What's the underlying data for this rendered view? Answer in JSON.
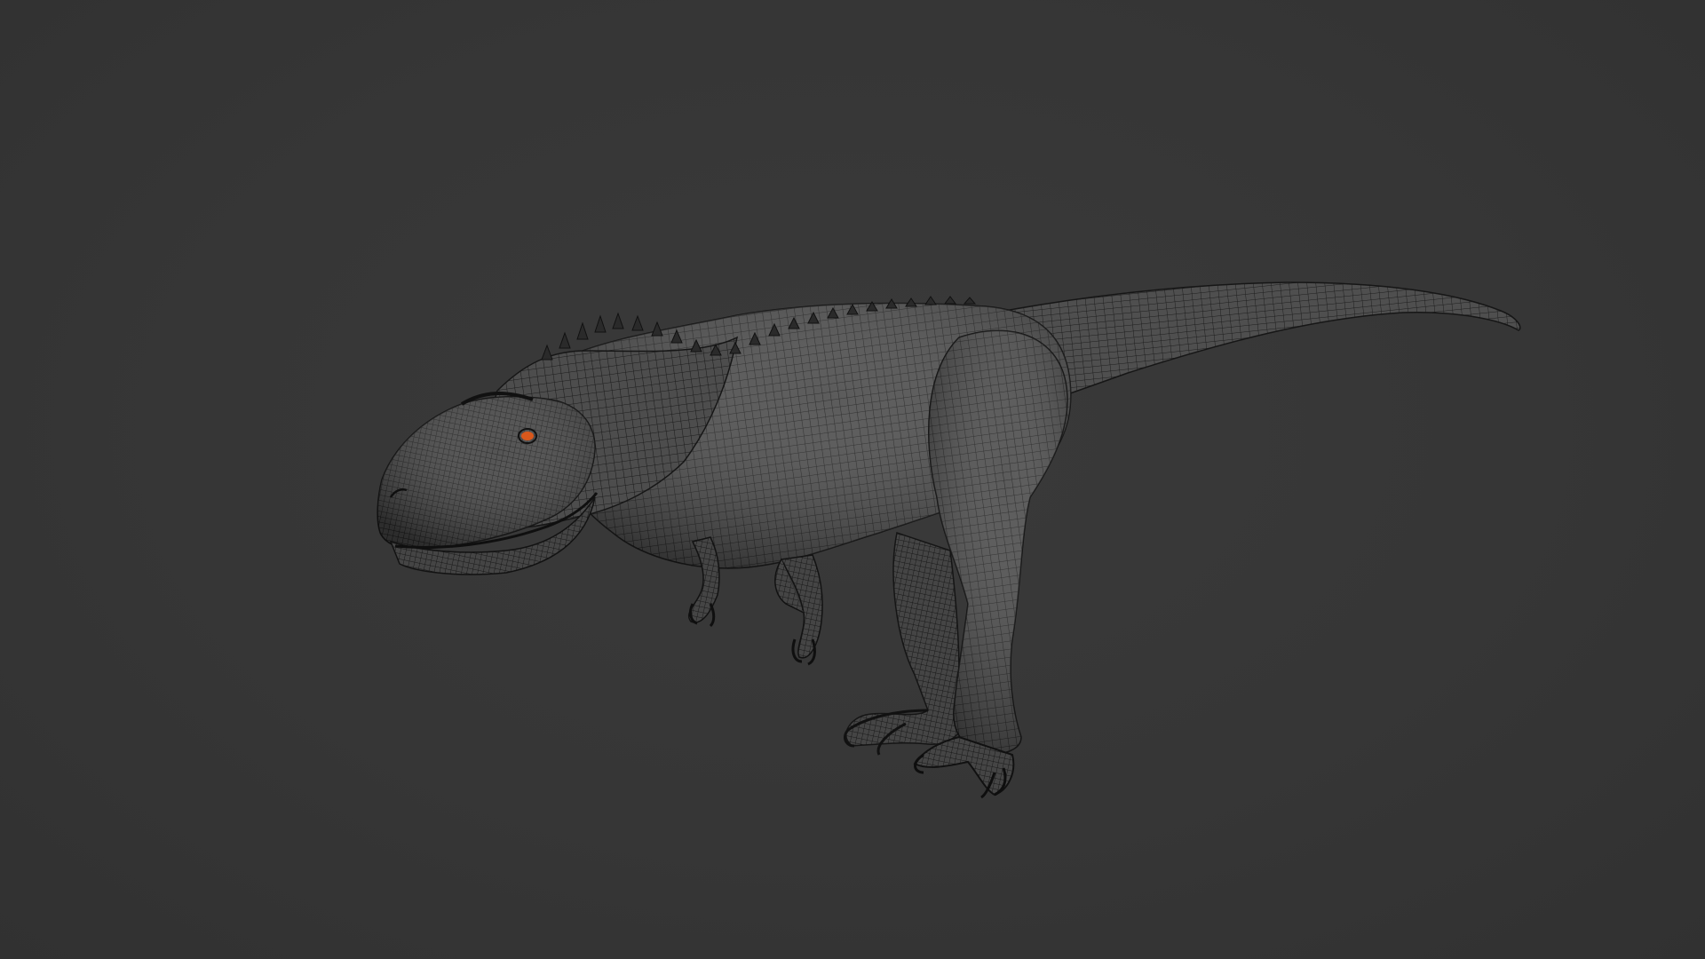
{
  "scene": {
    "background_color": "#353535",
    "model": {
      "subject": "dinosaur-wireframe-mesh",
      "shading": "wireframe-over-solid",
      "mesh_fill_color": "#4a4a4a",
      "wire_color": "#1a1a1a",
      "eye_color": "#d9581c"
    }
  }
}
